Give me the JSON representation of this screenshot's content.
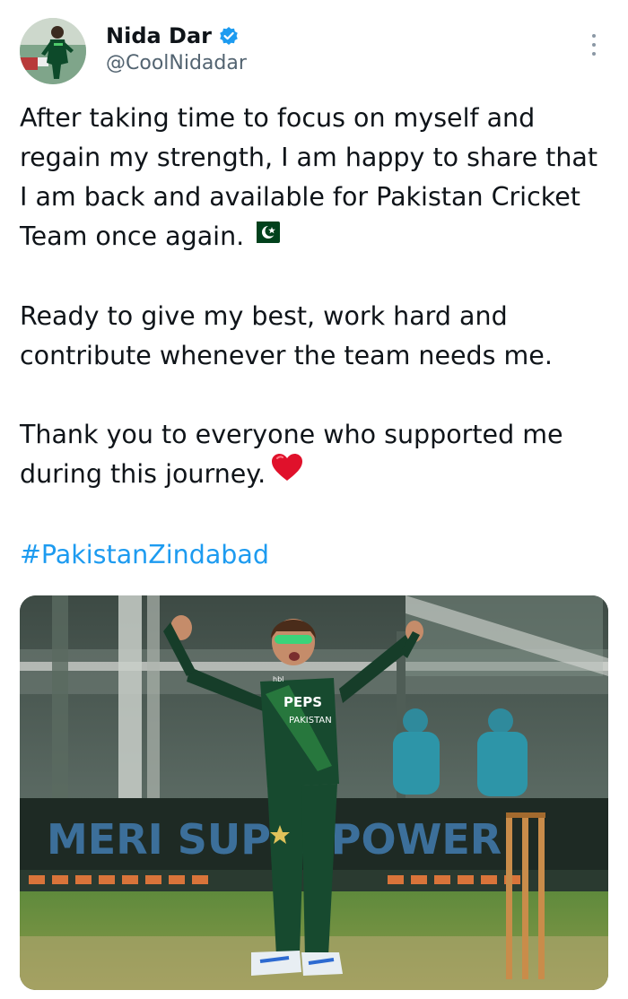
{
  "author": {
    "display_name": "Nida Dar",
    "handle": "@CoolNidadar",
    "verified": true
  },
  "tweet": {
    "paragraphs": [
      "After taking time to focus on myself and regain my strength, I am happy to share that I am back and available for Pakistan Cricket Team once again.",
      "Ready to give my best, work hard and contribute whenever the team needs me.",
      "Thank you to everyone who supported me during this journey."
    ],
    "hashtag": "#PakistanZindabad"
  },
  "media": {
    "jersey_sponsor": "PEPS",
    "jersey_country": "PAKISTAN",
    "boundary_banner": "MERI SUPERPOWER",
    "jersey_small_logo": "hbl"
  },
  "icons": {
    "verified": "verified-badge-icon",
    "more": "more-options-icon",
    "flag": "pakistan-flag-emoji",
    "heart": "red-heart-emoji"
  },
  "colors": {
    "text": "#0f1419",
    "secondary": "#536471",
    "link": "#1d9bf0",
    "verified": "#1d9bf0",
    "heart": "#e0112b",
    "flag_green": "#01411c"
  }
}
